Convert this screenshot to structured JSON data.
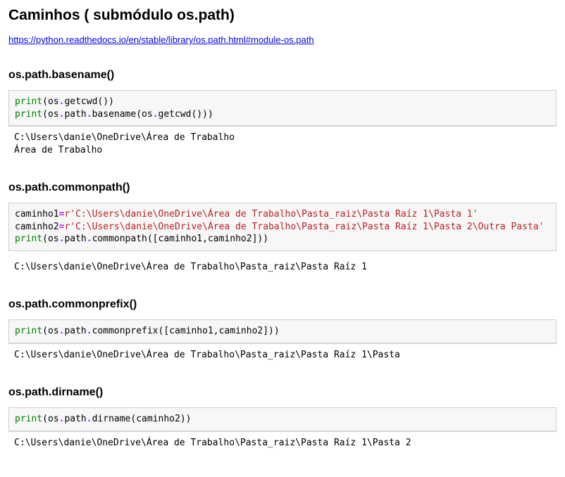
{
  "page_title": "Caminhos ( submódulo os.path)",
  "doc_link": "https://python.readthedocs.io/en/stable/library/os.path.html#module-os.path",
  "sections": {
    "basename": {
      "heading": "os.path.basename()",
      "code_tokens": [
        {
          "t": "fn",
          "v": "print"
        },
        {
          "t": "p",
          "v": "(os"
        },
        {
          "t": "op",
          "v": "."
        },
        {
          "t": "p",
          "v": "getcwd())"
        },
        {
          "t": "nl"
        },
        {
          "t": "fn",
          "v": "print"
        },
        {
          "t": "p",
          "v": "(os"
        },
        {
          "t": "op",
          "v": "."
        },
        {
          "t": "p",
          "v": "path"
        },
        {
          "t": "op",
          "v": "."
        },
        {
          "t": "p",
          "v": "basename(os"
        },
        {
          "t": "op",
          "v": "."
        },
        {
          "t": "p",
          "v": "getcwd()))"
        }
      ],
      "output": "C:\\Users\\danie\\OneDrive\\Área de Trabalho\nÁrea de Trabalho"
    },
    "commonpath": {
      "heading": "os.path.commonpath()",
      "code_tokens": [
        {
          "t": "p",
          "v": "caminho1"
        },
        {
          "t": "op",
          "v": "="
        },
        {
          "t": "sa",
          "v": "r'C:\\Users\\danie\\OneDrive\\Área de Trabalho\\Pasta_raiz\\Pasta Raíz 1\\Pasta 1'"
        },
        {
          "t": "nl"
        },
        {
          "t": "p",
          "v": "caminho2"
        },
        {
          "t": "op",
          "v": "="
        },
        {
          "t": "sa",
          "v": "r'C:\\Users\\danie\\OneDrive\\Área de Trabalho\\Pasta_raiz\\Pasta Raíz 1\\Pasta 2\\Outra Pasta'"
        },
        {
          "t": "nl"
        },
        {
          "t": "fn",
          "v": "print"
        },
        {
          "t": "p",
          "v": "(os"
        },
        {
          "t": "op",
          "v": "."
        },
        {
          "t": "p",
          "v": "path"
        },
        {
          "t": "op",
          "v": "."
        },
        {
          "t": "p",
          "v": "commonpath([caminho1,caminho2]))"
        }
      ],
      "output": "C:\\Users\\danie\\OneDrive\\Área de Trabalho\\Pasta_raiz\\Pasta Raíz 1"
    },
    "commonprefix": {
      "heading": "os.path.commonprefix()",
      "code_tokens": [
        {
          "t": "fn",
          "v": "print"
        },
        {
          "t": "p",
          "v": "(os"
        },
        {
          "t": "op",
          "v": "."
        },
        {
          "t": "p",
          "v": "path"
        },
        {
          "t": "op",
          "v": "."
        },
        {
          "t": "p",
          "v": "commonprefix([caminho1,caminho2]))"
        }
      ],
      "output": "C:\\Users\\danie\\OneDrive\\Área de Trabalho\\Pasta_raiz\\Pasta Raíz 1\\Pasta "
    },
    "dirname": {
      "heading": "os.path.dirname()",
      "code_tokens": [
        {
          "t": "fn",
          "v": "print"
        },
        {
          "t": "p",
          "v": "(os"
        },
        {
          "t": "op",
          "v": "."
        },
        {
          "t": "p",
          "v": "path"
        },
        {
          "t": "op",
          "v": "."
        },
        {
          "t": "p",
          "v": "dirname(caminho2))"
        }
      ],
      "output": "C:\\Users\\danie\\OneDrive\\Área de Trabalho\\Pasta_raiz\\Pasta Raíz 1\\Pasta 2"
    }
  }
}
